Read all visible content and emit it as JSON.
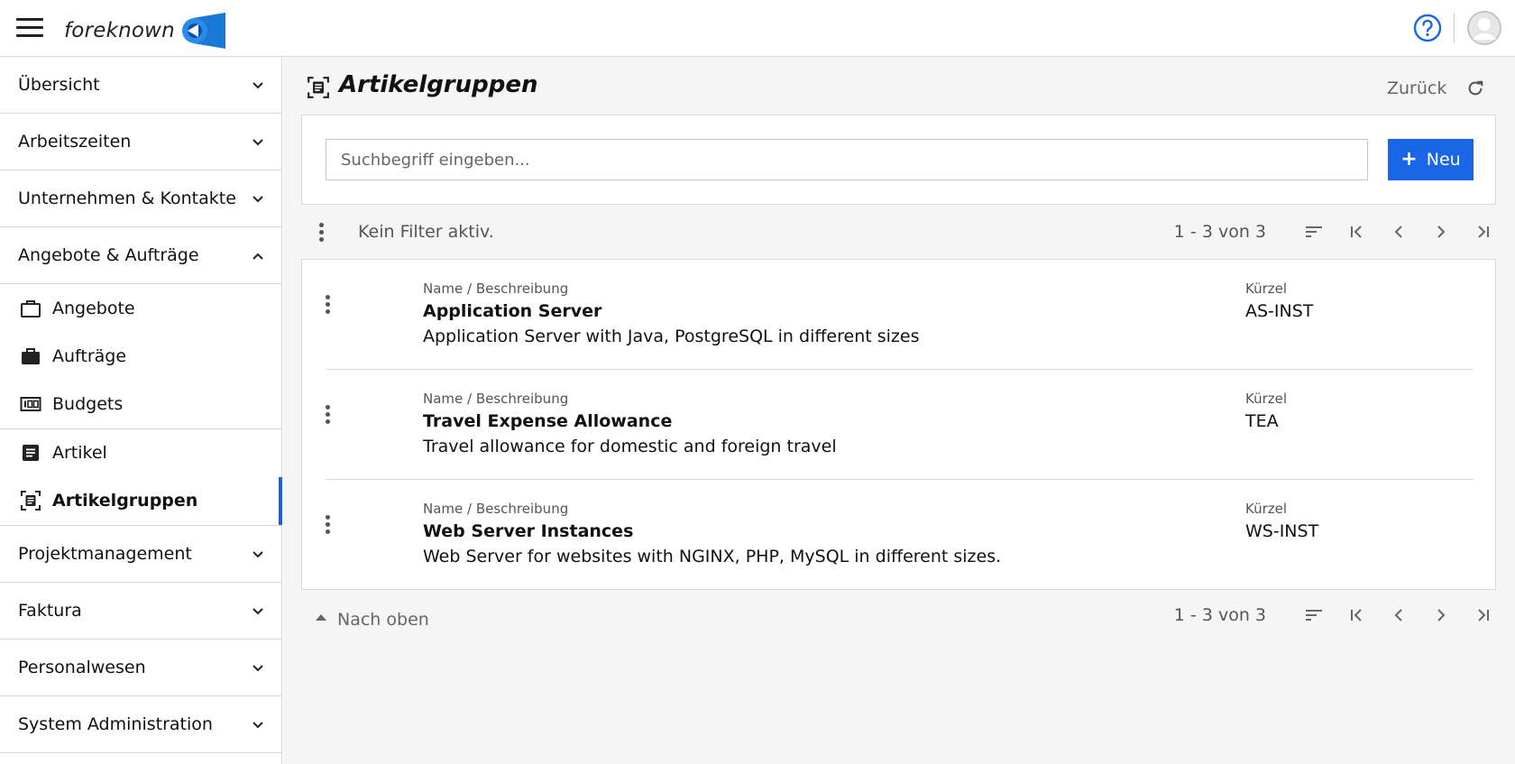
{
  "app": {
    "logo_text": "foreknown",
    "colors": {
      "accent": "#1a66e6",
      "active_indicator": "#1a5fd8",
      "logo_blue": "#1778d6"
    }
  },
  "topbar": {
    "menu_icon": "hamburger-icon",
    "help_icon": "help-circle-icon",
    "avatar_icon": "user-avatar-icon"
  },
  "sidebar": {
    "groups_top": [
      {
        "label": "Übersicht",
        "icon": "chevron-down-icon"
      },
      {
        "label": "Arbeitszeiten",
        "icon": "chevron-down-icon"
      },
      {
        "label": "Unternehmen & Kontakte",
        "icon": "chevron-down-icon"
      },
      {
        "label": "Angebote & Aufträge",
        "icon": "chevron-up-icon",
        "expanded": true
      }
    ],
    "sub_items": [
      {
        "label": "Angebote",
        "icon": "briefcase-outline-icon"
      },
      {
        "label": "Aufträge",
        "icon": "briefcase-filled-icon"
      },
      {
        "label": "Budgets",
        "icon": "counter-icon"
      },
      {
        "label": "Artikel",
        "icon": "article-icon"
      },
      {
        "label": "Artikelgruppen",
        "icon": "article-group-icon",
        "active": true
      }
    ],
    "groups_bottom": [
      {
        "label": "Projektmanagement",
        "icon": "chevron-down-icon"
      },
      {
        "label": "Faktura",
        "icon": "chevron-down-icon"
      },
      {
        "label": "Personalwesen",
        "icon": "chevron-down-icon"
      },
      {
        "label": "System Administration",
        "icon": "chevron-down-icon"
      }
    ]
  },
  "page": {
    "title": "Artikelgruppen",
    "title_icon": "article-group-icon",
    "back_label": "Zurück",
    "refresh_icon": "refresh-icon"
  },
  "search": {
    "placeholder": "Suchbegriff eingeben...",
    "value": "",
    "new_label": "Neu"
  },
  "filter": {
    "text": "Kein Filter aktiv.",
    "count": "1 - 3 von 3"
  },
  "list": {
    "columns": {
      "name": "Name / Beschreibung",
      "code": "Kürzel"
    },
    "rows": [
      {
        "name": "Application Server",
        "description": "Application Server with Java, PostgreSQL in different sizes",
        "code": "AS-INST"
      },
      {
        "name": "Travel Expense Allowance",
        "description": "Travel allowance for domestic and foreign travel",
        "code": "TEA"
      },
      {
        "name": "Web Server Instances",
        "description": "Web Server for websites with NGINX, PHP, MySQL in different sizes.",
        "code": "WS-INST"
      }
    ]
  },
  "footer": {
    "to_top_label": "Nach oben",
    "count": "1 - 3 von 3"
  }
}
